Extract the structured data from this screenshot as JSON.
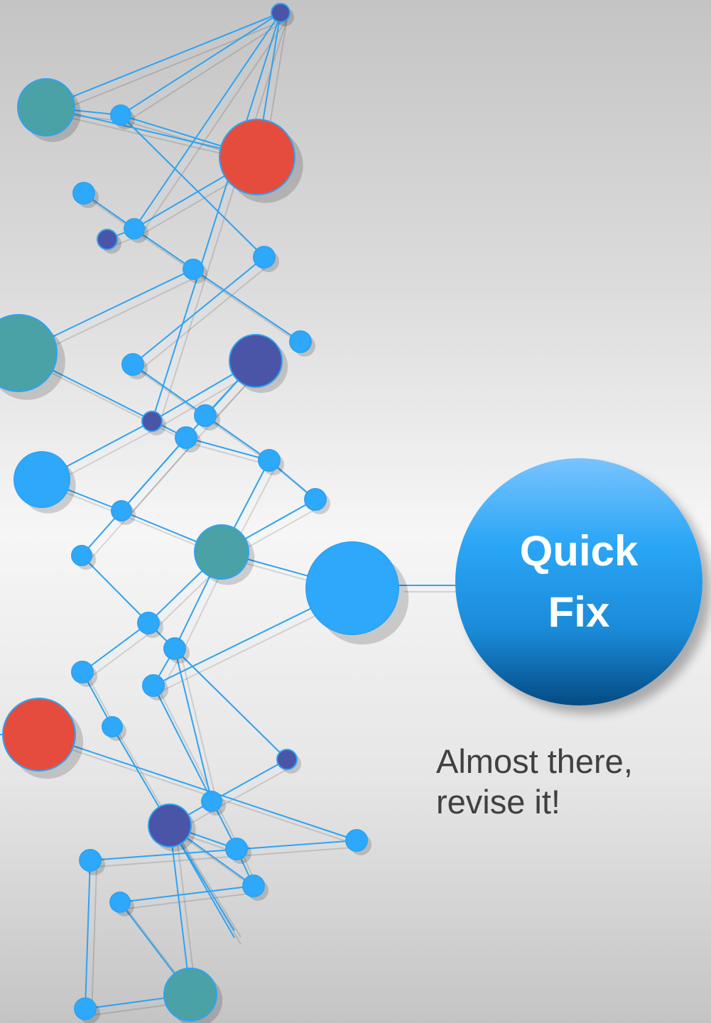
{
  "badge": {
    "title": "Quick Fix"
  },
  "message": {
    "text": "Almost there, revise it!"
  },
  "colors": {
    "edge": "#2ea3f2",
    "blue": "#2ea8fb",
    "navy": "#4a55a8",
    "teal": "#4aa2a6",
    "red": "#e64c3e",
    "badge_top": "#79c3ff",
    "badge_bottom": "#044b83",
    "message_text": "#404040"
  }
}
